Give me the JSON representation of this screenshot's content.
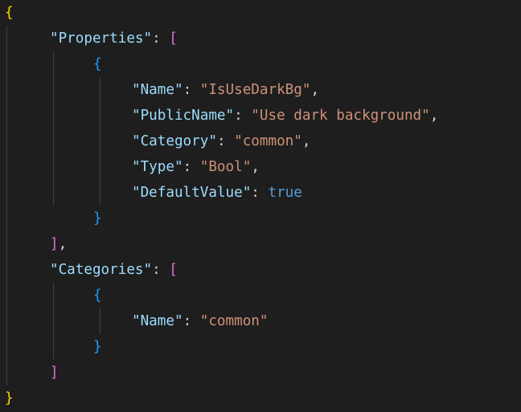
{
  "code": {
    "l1": {
      "open_brace": "{"
    },
    "l2": {
      "key": "\"Properties\"",
      "sep": ": ",
      "open": "["
    },
    "l3": {
      "open": "{"
    },
    "l4": {
      "key": "\"Name\"",
      "sep": ": ",
      "value": "\"IsUseDarkBg\"",
      "comma": ","
    },
    "l5": {
      "key": "\"PublicName\"",
      "sep": ": ",
      "value": "\"Use dark background\"",
      "comma": ","
    },
    "l6": {
      "key": "\"Category\"",
      "sep": ": ",
      "value": "\"common\"",
      "comma": ","
    },
    "l7": {
      "key": "\"Type\"",
      "sep": ": ",
      "value": "\"Bool\"",
      "comma": ","
    },
    "l8": {
      "key": "\"DefaultValue\"",
      "sep": ": ",
      "value": "true"
    },
    "l9": {
      "close": "}"
    },
    "l10": {
      "close": "]",
      "comma": ","
    },
    "l11": {
      "key": "\"Categories\"",
      "sep": ": ",
      "open": "["
    },
    "l12": {
      "open": "{"
    },
    "l13": {
      "key": "\"Name\"",
      "sep": ": ",
      "value": "\"common\""
    },
    "l14": {
      "close": "}"
    },
    "l15": {
      "close": "]"
    },
    "l16": {
      "close_brace": "}"
    }
  },
  "colors": {
    "background": "#1e1e1e",
    "json_key": "#9cdcfe",
    "json_string": "#ce9178",
    "json_boolean": "#569cd6",
    "bracket_level_1": "#ffd700",
    "bracket_level_2": "#da70d6",
    "bracket_level_3": "#179fff",
    "indent_guide": "#404040"
  }
}
